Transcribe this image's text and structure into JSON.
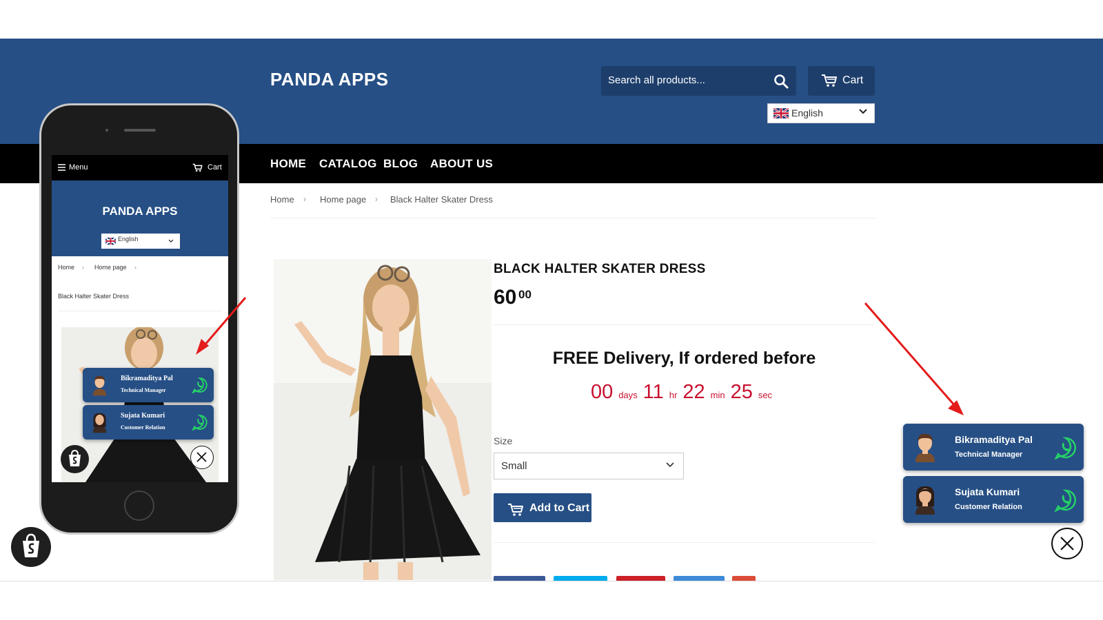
{
  "store": {
    "brand": "PANDA APPS",
    "search_placeholder": "Search all products...",
    "cart_label": "Cart",
    "language": "English"
  },
  "nav": [
    "HOME",
    "CATALOG",
    "BLOG",
    "ABOUT US"
  ],
  "breadcrumb": [
    "Home",
    "Home page",
    "Black Halter Skater Dress"
  ],
  "product": {
    "title": "BLACK HALTER SKATER DRESS",
    "price_main": "60",
    "price_cents": "00",
    "free_delivery": "FREE Delivery, If ordered before",
    "countdown": {
      "days": "00",
      "days_label": "days",
      "hours": "11",
      "hours_label": "hr",
      "minutes": "22",
      "minutes_label": "min",
      "seconds": "25",
      "seconds_label": "sec"
    },
    "size_label": "Size",
    "size_value": "Small",
    "add_to_cart": "Add to Cart"
  },
  "whatsapp_agents": [
    {
      "name": "Bikramaditya Pal",
      "role": "Technical Manager"
    },
    {
      "name": "Sujata Kumari",
      "role": "Customer Relation"
    }
  ],
  "mobile": {
    "menu_label": "Menu",
    "cart_label": "Cart",
    "brand": "PANDA APPS",
    "language": "English",
    "breadcrumb": [
      "Home",
      "Home page"
    ],
    "product_title": "Black Halter Skater Dress"
  },
  "colors": {
    "header_blue": "#264f85",
    "nav_black": "#000000",
    "countdown_red": "#c8102e",
    "whatsapp_green": "#25d366",
    "arrow_red": "#e31b1b"
  },
  "icons": [
    "search-icon",
    "cart-icon",
    "uk-flag-icon",
    "chevron-down-icon",
    "whatsapp-icon",
    "close-icon",
    "shopify-icon",
    "hamburger-icon",
    "avatar-icon",
    "annotation-arrow"
  ]
}
